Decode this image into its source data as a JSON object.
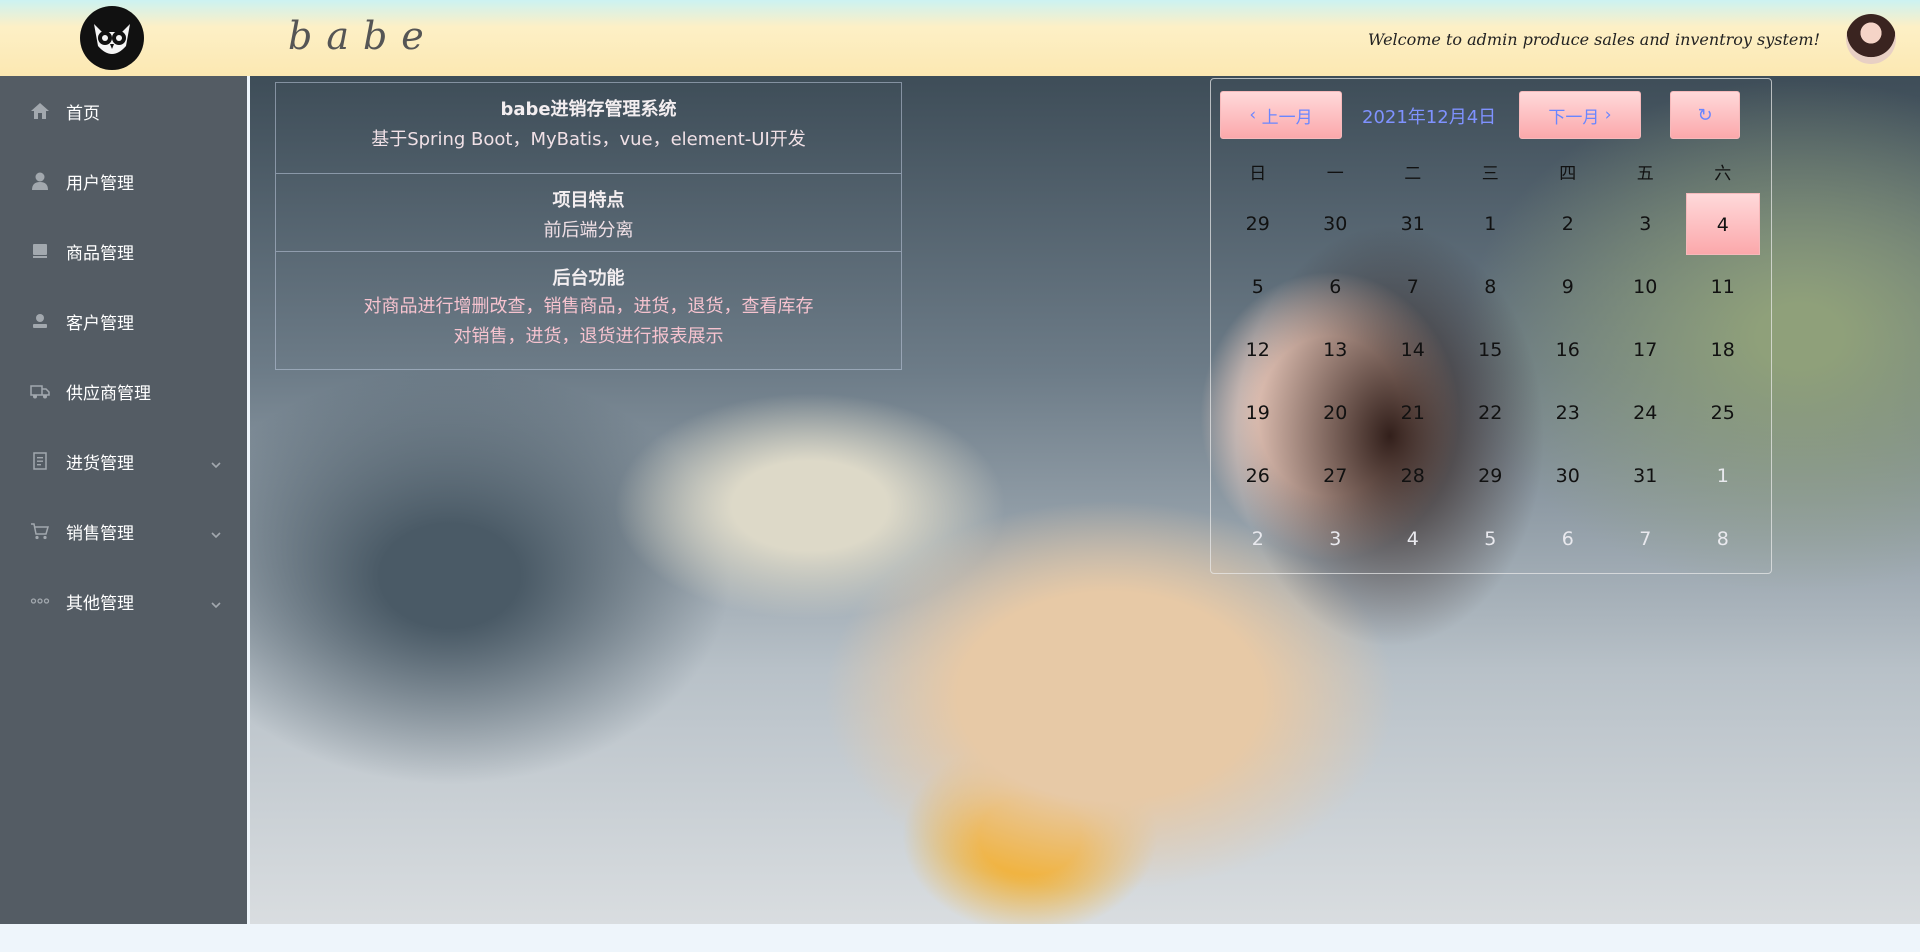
{
  "header": {
    "brand": "babe",
    "welcome": "Welcome to admin produce sales and inventroy system!"
  },
  "sidebar": {
    "items": [
      {
        "label": "首页",
        "icon": "home-icon"
      },
      {
        "label": "用户管理",
        "icon": "user-icon"
      },
      {
        "label": "商品管理",
        "icon": "goods-icon"
      },
      {
        "label": "客户管理",
        "icon": "customer-icon"
      },
      {
        "label": "供应商管理",
        "icon": "truck-icon"
      },
      {
        "label": "进货管理",
        "icon": "document-icon",
        "expandable": true
      },
      {
        "label": "销售管理",
        "icon": "cart-icon",
        "expandable": true
      },
      {
        "label": "其他管理",
        "icon": "more-icon",
        "expandable": true
      }
    ]
  },
  "info": {
    "title": "babe进销存管理系统",
    "subtitle": "基于Spring Boot，MyBatis，vue，element-UI开发",
    "features_title": "项目特点",
    "features_text": "前后端分离",
    "backend_title": "后台功能",
    "backend_line1": "对商品进行增删改查，销售商品，进货，退货，查看库存",
    "backend_line2": "对销售，进货，退货进行报表展示"
  },
  "calendar": {
    "prev_label": "上一月",
    "next_label": "下一月",
    "title": "2021年12月4日",
    "weekdays": [
      "日",
      "一",
      "二",
      "三",
      "四",
      "五",
      "六"
    ],
    "weeks": [
      [
        "29",
        "30",
        "31",
        "1",
        "2",
        "3",
        "4"
      ],
      [
        "5",
        "6",
        "7",
        "8",
        "9",
        "10",
        "11"
      ],
      [
        "12",
        "13",
        "14",
        "15",
        "16",
        "17",
        "18"
      ],
      [
        "19",
        "20",
        "21",
        "22",
        "23",
        "24",
        "25"
      ],
      [
        "26",
        "27",
        "28",
        "29",
        "30",
        "31",
        "1"
      ],
      [
        "2",
        "3",
        "4",
        "5",
        "6",
        "7",
        "8"
      ]
    ],
    "today": "4",
    "accent_color": "#fba8ab"
  }
}
